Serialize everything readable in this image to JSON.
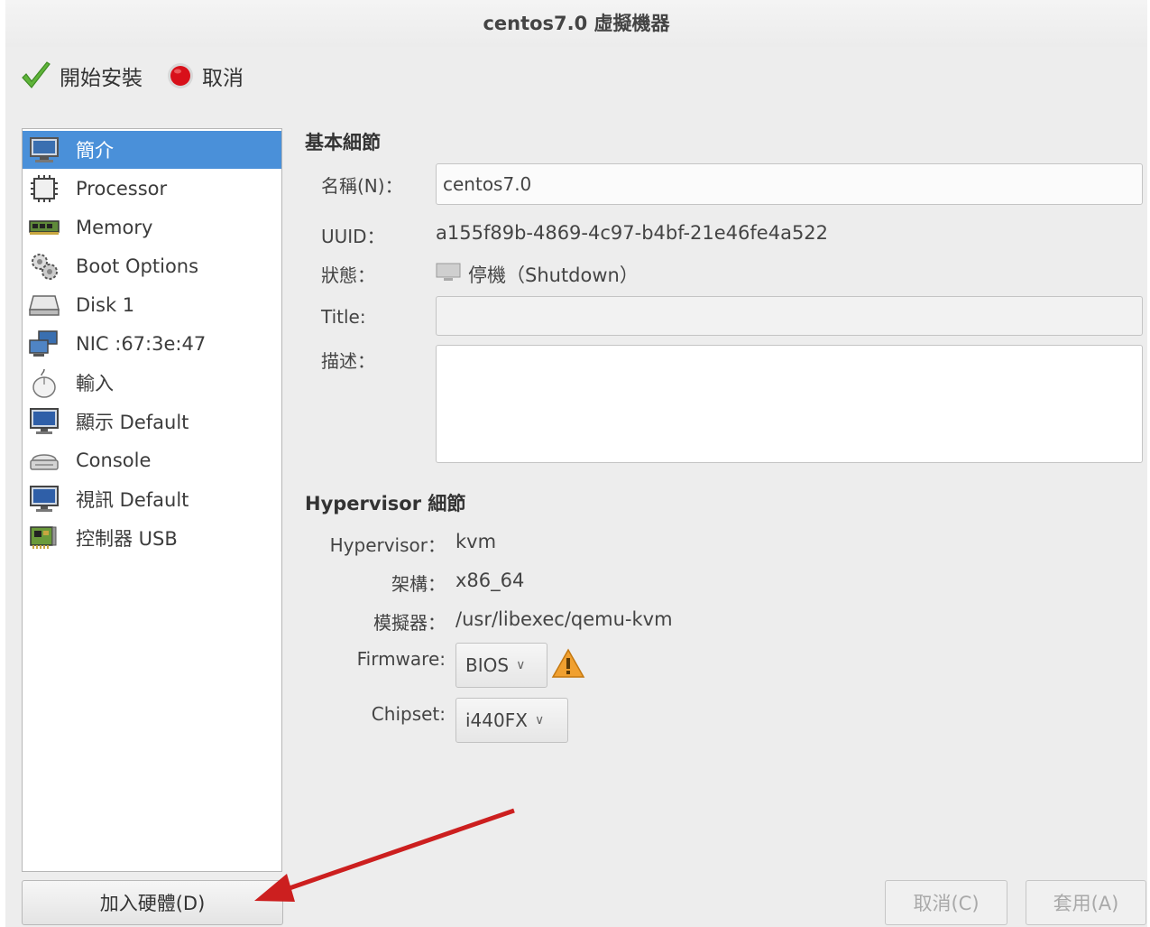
{
  "window": {
    "title": "centos7.0 虛擬機器"
  },
  "toolbar": {
    "begin_install": "開始安裝",
    "cancel": "取消"
  },
  "sidebar": {
    "items": [
      {
        "label": "簡介",
        "icon": "monitor-icon",
        "selected": true
      },
      {
        "label": "Processor",
        "icon": "cpu-chip-icon"
      },
      {
        "label": "Memory",
        "icon": "memory-stick-icon"
      },
      {
        "label": "Boot Options",
        "icon": "gears-icon"
      },
      {
        "label": "Disk 1",
        "icon": "disk-drive-icon"
      },
      {
        "label": "NIC :67:3e:47",
        "icon": "network-icon"
      },
      {
        "label": "輸入",
        "icon": "mouse-icon"
      },
      {
        "label": "顯示 Default",
        "icon": "display-icon"
      },
      {
        "label": "Console",
        "icon": "console-icon"
      },
      {
        "label": "視訊 Default",
        "icon": "video-icon"
      },
      {
        "label": "控制器 USB",
        "icon": "controller-card-icon"
      }
    ],
    "add_hardware": "加入硬體(D)"
  },
  "basic": {
    "title": "基本細節",
    "name_label": "名稱(N)：",
    "name_value": "centos7.0",
    "uuid_label": "UUID：",
    "uuid_value": "a155f89b-4869-4c97-b4bf-21e46fe4a522",
    "status_label": "狀態：",
    "status_value": "停機（Shutdown）",
    "title_label": "Title:",
    "title_value": "",
    "desc_label": "描述：",
    "desc_value": ""
  },
  "hypervisor": {
    "title": "Hypervisor 細節",
    "hv_label": "Hypervisor：",
    "hv_value": "kvm",
    "arch_label": "架構：",
    "arch_value": "x86_64",
    "emu_label": "模擬器：",
    "emu_value": "/usr/libexec/qemu-kvm",
    "fw_label": "Firmware:",
    "fw_value": "BIOS",
    "chipset_label": "Chipset:",
    "chipset_value": "i440FX"
  },
  "buttons": {
    "cancel": "取消(C)",
    "apply": "套用(A)"
  },
  "colors": {
    "selection": "#4a90d9",
    "arrow": "#cc1f1f",
    "warning": "#f0a030"
  }
}
